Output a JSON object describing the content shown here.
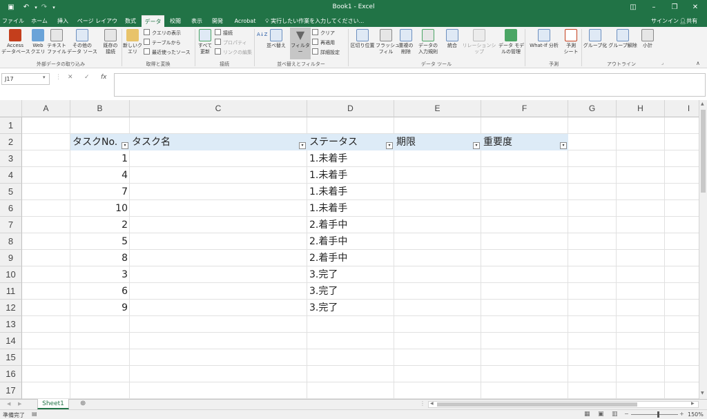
{
  "window": {
    "title": "Book1 - Excel"
  },
  "tabs": [
    {
      "label": "ファイル"
    },
    {
      "label": "ホーム"
    },
    {
      "label": "挿入"
    },
    {
      "label": "ページ レイアウト"
    },
    {
      "label": "数式"
    },
    {
      "label": "データ"
    },
    {
      "label": "校閲"
    },
    {
      "label": "表示"
    },
    {
      "label": "開発"
    },
    {
      "label": "Acrobat"
    }
  ],
  "tell_me": "実行したい作業を入力してください...",
  "signin": "サインイン",
  "share": "共有",
  "ribbon": {
    "access": "Access\nデータベース",
    "web": "Web\nクエリ",
    "text": "テキスト\nファイル",
    "other": "その他の\nデータ ソース",
    "existing": "既存の\n接続",
    "new_query": "新しいク\nエリ",
    "show_query": "クエリの表示",
    "from_table": "テーブルから",
    "recent_sources": "最近使ったソース",
    "refresh_all": "すべて\n更新",
    "connections": "接続",
    "properties": "プロパティ",
    "edit_links": "リンクの編集",
    "sort": "並べ替え",
    "filter": "フィルター",
    "clear": "クリア",
    "reapply": "再適用",
    "advanced": "詳細設定",
    "text_to_columns": "区切り位置",
    "flash_fill": "フラッシュ\nフィル",
    "remove_duplicates": "重複の\n削除",
    "data_validation": "データの\n入力規則",
    "consolidate": "統合",
    "relationships": "リレーションシップ",
    "data_model": "データ モデ\nルの管理",
    "what_if": "What-If 分析",
    "forecast_sheet": "予測\nシート",
    "group": "グループ化",
    "ungroup": "グループ解除",
    "subtotal": "小計",
    "groups": {
      "external": "外部データの取り込み",
      "get_transform": "取得と変換",
      "connections": "接続",
      "sort_filter": "並べ替えとフィルター",
      "data_tools": "データ ツール",
      "forecast": "予測",
      "outline": "アウトライン"
    }
  },
  "formula_bar": {
    "name_box": "J17",
    "cancel": "✕",
    "enter": "✓",
    "fx": "fx",
    "formula": ""
  },
  "columns": [
    "A",
    "B",
    "C",
    "D",
    "E",
    "F",
    "G",
    "H",
    "I"
  ],
  "rows": [
    "1",
    "2",
    "3",
    "4",
    "5",
    "6",
    "7",
    "8",
    "9",
    "10",
    "11",
    "12",
    "13",
    "14",
    "15",
    "16",
    "17"
  ],
  "table": {
    "headers": [
      "タスクNo.",
      "タスク名",
      "ステータス",
      "期限",
      "重要度"
    ],
    "rows": [
      {
        "no": "1",
        "status": "1.未着手"
      },
      {
        "no": "4",
        "status": "1.未着手"
      },
      {
        "no": "7",
        "status": "1.未着手"
      },
      {
        "no": "10",
        "status": "1.未着手"
      },
      {
        "no": "2",
        "status": "2.着手中"
      },
      {
        "no": "5",
        "status": "2.着手中"
      },
      {
        "no": "8",
        "status": "2.着手中"
      },
      {
        "no": "3",
        "status": "3.完了"
      },
      {
        "no": "6",
        "status": "3.完了"
      },
      {
        "no": "9",
        "status": "3.完了"
      }
    ]
  },
  "sheets": [
    {
      "name": "Sheet1"
    }
  ],
  "status": {
    "ready": "準備完了",
    "zoom": "150%"
  },
  "colors": {
    "brand": "#217346",
    "table_header": "#ddebf7"
  }
}
